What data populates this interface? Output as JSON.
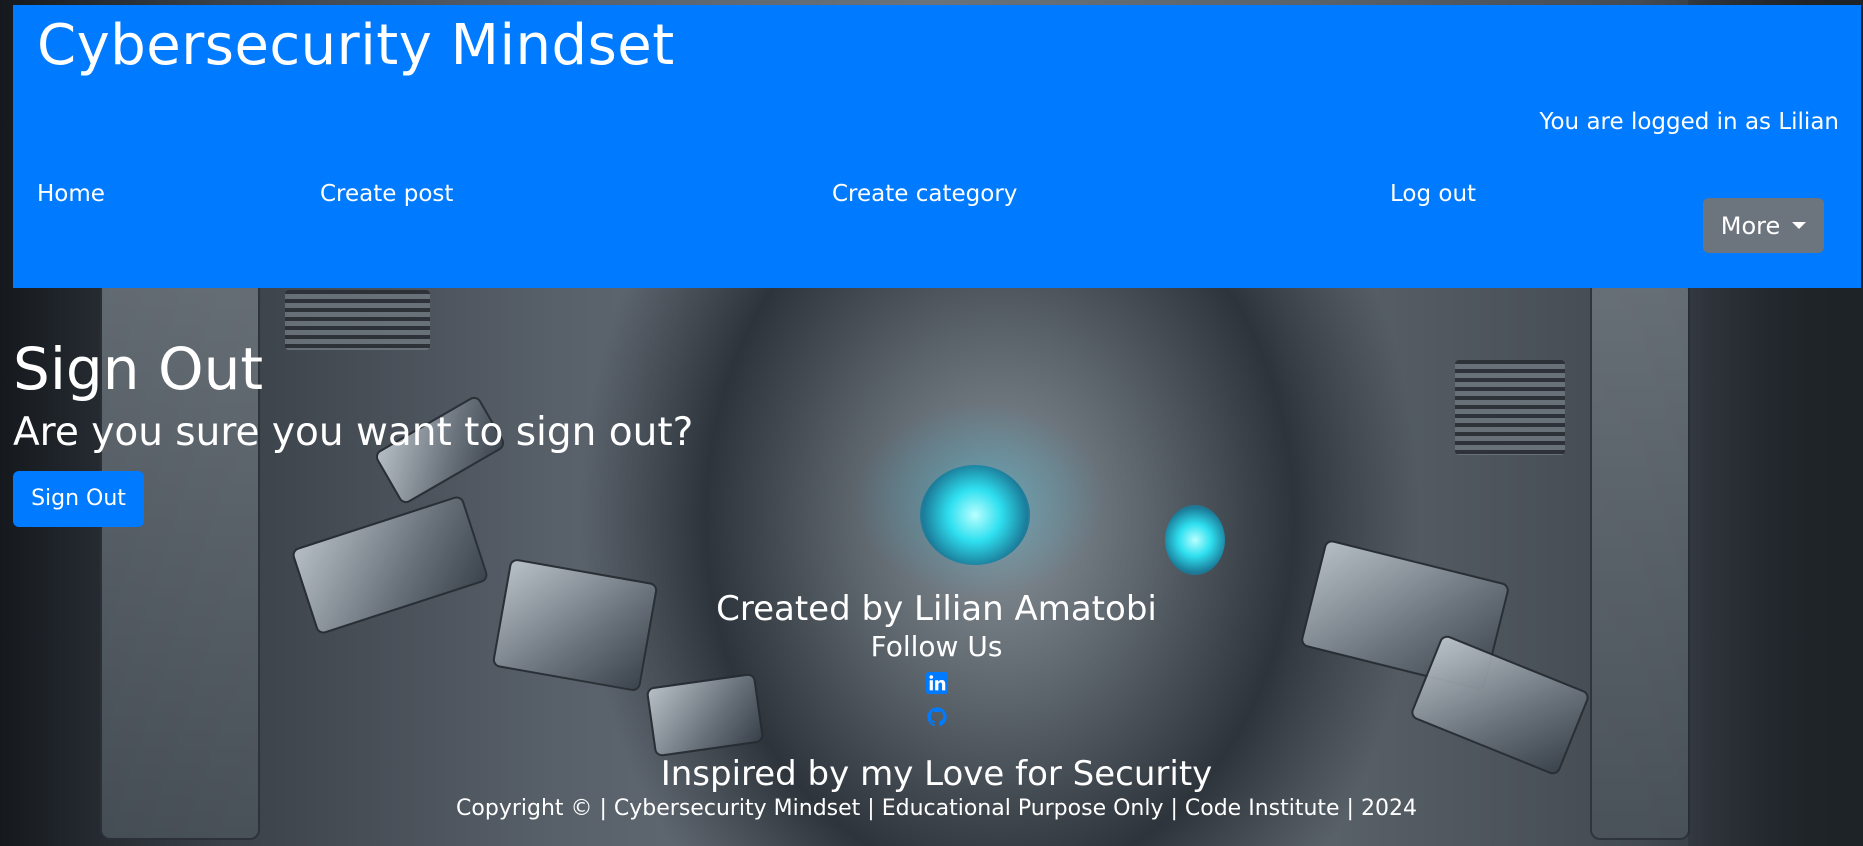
{
  "header": {
    "brand": "Cybersecurity Mindset",
    "login_status": "You are logged in as Lilian",
    "nav": [
      {
        "label": "Home"
      },
      {
        "label": "Create post"
      },
      {
        "label": "Create category"
      },
      {
        "label": "Log out"
      }
    ],
    "more_label": "More",
    "accent_color": "#007bff"
  },
  "main": {
    "title": "Sign Out",
    "subtitle": "Are you sure you want to sign out?",
    "button_label": "Sign Out"
  },
  "footer": {
    "credit": "Created by Lilian Amatobi",
    "follow": "Follow Us",
    "social_icons": [
      "linkedin-icon",
      "github-icon"
    ],
    "inspired": "Inspired by my Love for Security",
    "copyright": "Copyright © | Cybersecurity Mindset | Educational Purpose Only | Code Institute | 2024"
  },
  "colors": {
    "primary": "#007bff",
    "secondary_button": "#6c757d",
    "text": "#ffffff"
  }
}
